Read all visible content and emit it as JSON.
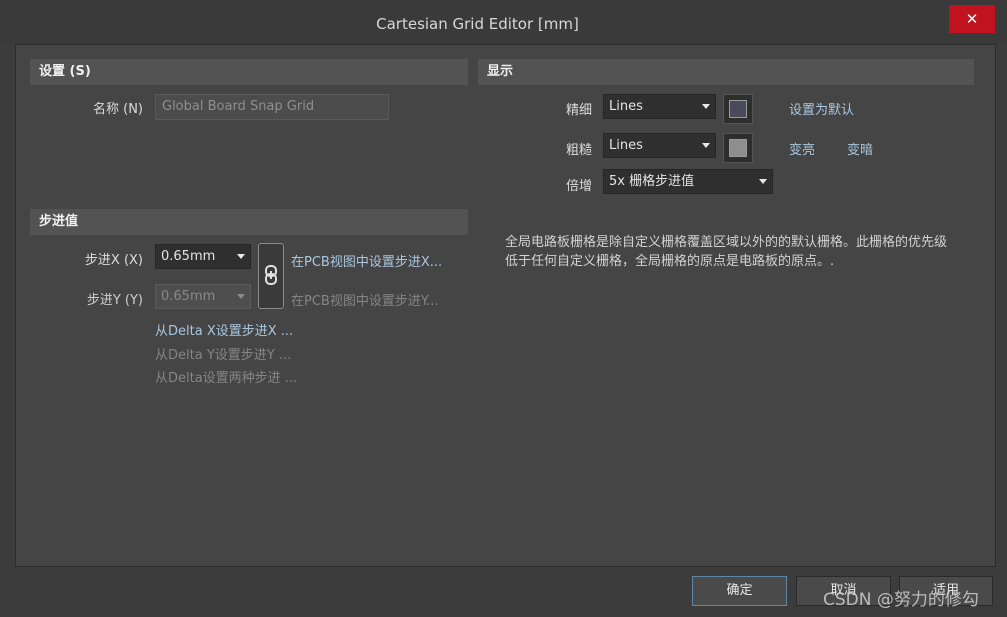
{
  "window": {
    "title": "Cartesian Grid Editor [mm]",
    "close_label": "✕"
  },
  "settings": {
    "header": "设置 (S)",
    "name_label": "名称 (N)",
    "name_value": "Global Board Snap Grid"
  },
  "step": {
    "header": "步进值",
    "x_label": "步进X (X)",
    "x_value": "0.65mm",
    "y_label": "步进Y (Y)",
    "y_value": "0.65mm",
    "set_x_from_pcb": "在PCB视图中设置步进X...",
    "set_y_from_pcb": "在PCB视图中设置步进Y...",
    "from_delta_x": "从Delta X设置步进X ...",
    "from_delta_y": "从Delta Y设置步进Y ...",
    "from_delta_both": "从Delta设置两种步进 ..."
  },
  "display": {
    "header": "显示",
    "fine_label": "精细",
    "fine_value": "Lines",
    "fine_color": "#4a4a5a",
    "coarse_label": "粗糙",
    "coarse_value": "Lines",
    "coarse_color": "#8e8e8e",
    "multiplier_label": "倍增",
    "multiplier_value": "5x 栅格步进值",
    "set_default": "设置为默认",
    "lighter": "变亮",
    "darker": "变暗",
    "description": "全局电路板栅格是除自定义栅格覆盖区域以外的的默认栅格。此栅格的优先级低于任何自定义栅格，全局栅格的原点是电路板的原点。."
  },
  "footer": {
    "ok": "确定",
    "cancel": "取消",
    "apply": "适用"
  },
  "watermark": "CSDN @努力的修勾"
}
